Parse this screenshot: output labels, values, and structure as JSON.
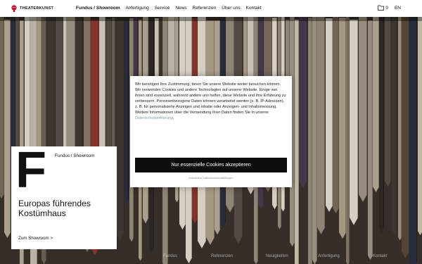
{
  "header": {
    "logo_text": "THEATERKUNST",
    "nav": [
      {
        "label": "Fundus / Showroom"
      },
      {
        "label": "Anfertigung"
      },
      {
        "label": "Service"
      },
      {
        "label": "News"
      },
      {
        "label": "Referenzen"
      },
      {
        "label": "Über uns"
      },
      {
        "label": "Kontakt"
      }
    ],
    "cart_count": "0",
    "language": "EN"
  },
  "modal": {
    "text": "Wir benötigen Ihre Zustimmung, bevor Sie unsere Website weiter besuchen können. Wir verwenden Cookies und andere Technologien auf unserer Website. Einige von ihnen sind essenziell, während andere uns helfen, diese Website und Ihre Erfahrung zu verbessern. Personenbezogene Daten können verarbeitet werden (z. B. IP-Adressen), z. B. für personalisierte Anzeigen und Inhalte oder Anzeigen- und Inhaltsmessung. Weitere Informationen über die Verwendung Ihrer Daten finden Sie in unserer ",
    "privacy_link": "Datenschutzerklärung",
    "text_end": ".",
    "accept_label": "Nur essenzielle Cookies akzeptieren",
    "settings_label": "Individuelle Datenschutzeinstellungen"
  },
  "card": {
    "letter": "F",
    "label": "Fundus / Showroom",
    "headline": "Europas führendes Kostümhaus",
    "link": "Zum Showroom >"
  },
  "bottom_tabs": [
    {
      "label": "Fundus"
    },
    {
      "label": "Referenzen"
    },
    {
      "label": "Neuigkeiten"
    },
    {
      "label": "Anfertigung"
    },
    {
      "label": "Kontakt"
    }
  ],
  "colors": {
    "accent": "#c8102e",
    "button": "#0d0d0d",
    "link": "#8aa0b8"
  }
}
